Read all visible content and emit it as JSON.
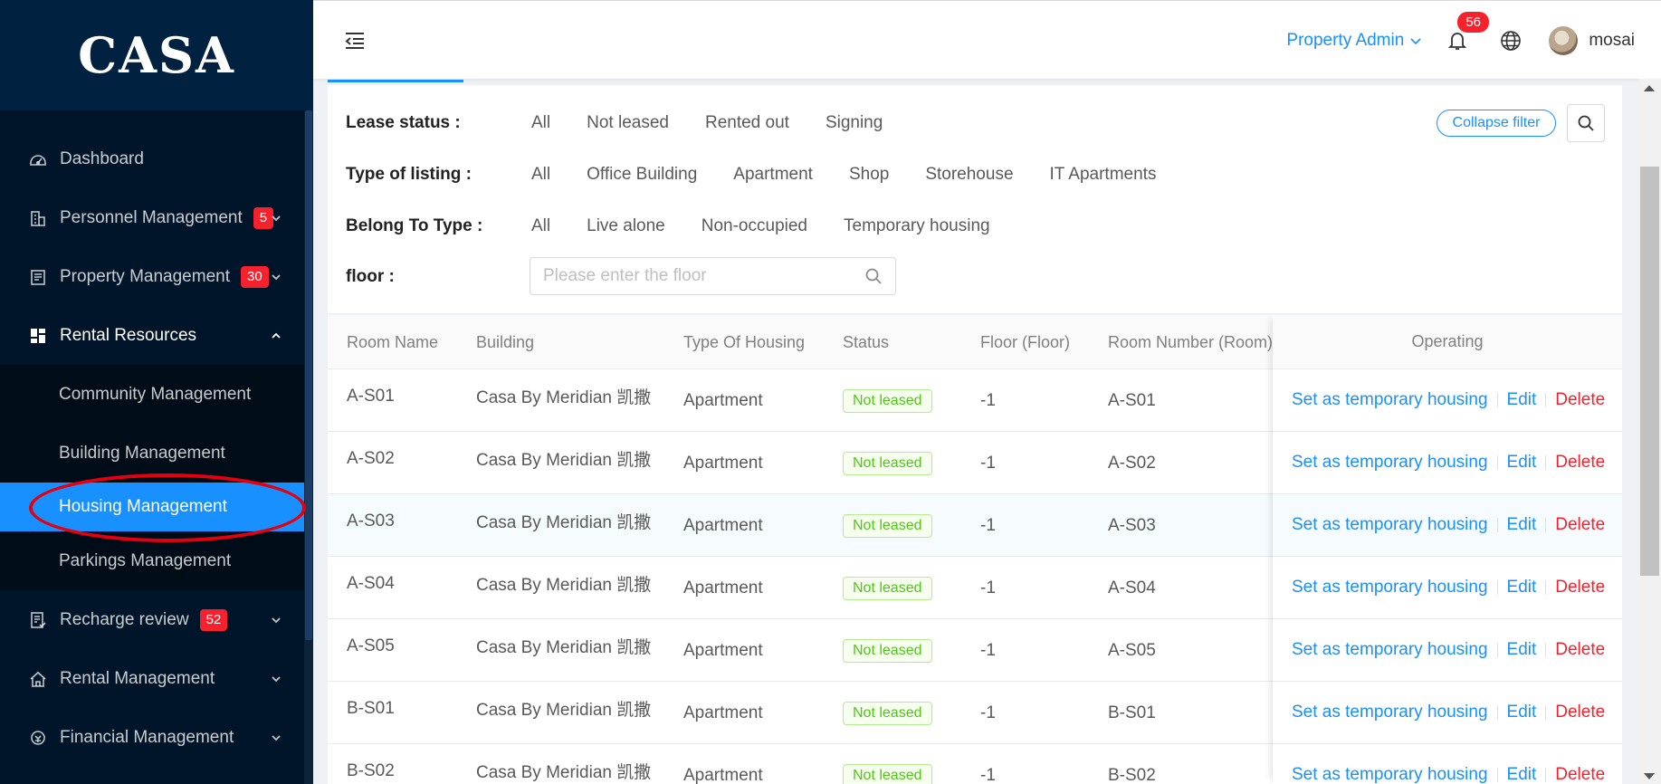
{
  "brand": {
    "logo": "CASA"
  },
  "sidebar": {
    "items": [
      {
        "label": "Dashboard",
        "icon": "dashboard-icon"
      },
      {
        "label": "Personnel Management",
        "icon": "building-icon",
        "badge": "5"
      },
      {
        "label": "Property Management",
        "icon": "document-icon",
        "badge": "30"
      },
      {
        "label": "Rental Resources",
        "icon": "grid-icon"
      },
      {
        "label": "Recharge review",
        "icon": "review-icon",
        "badge": "52"
      },
      {
        "label": "Rental Management",
        "icon": "house-icon"
      },
      {
        "label": "Financial Management",
        "icon": "finance-icon"
      }
    ],
    "submenu": [
      {
        "label": "Community Management"
      },
      {
        "label": "Building Management"
      },
      {
        "label": "Housing Management"
      },
      {
        "label": "Parkings Management"
      }
    ]
  },
  "header": {
    "role": "Property Admin",
    "notification_count": "56",
    "username": "mosai"
  },
  "filters": {
    "lease_status": {
      "label": "Lease status :",
      "options": [
        "All",
        "Not leased",
        "Rented out",
        "Signing"
      ]
    },
    "listing_type": {
      "label": "Type of listing :",
      "options": [
        "All",
        "Office Building",
        "Apartment",
        "Shop",
        "Storehouse",
        "IT Apartments"
      ]
    },
    "belong_to": {
      "label": "Belong To Type :",
      "options": [
        "All",
        "Live alone",
        "Non-occupied",
        "Temporary housing"
      ]
    },
    "floor": {
      "label": "floor :",
      "placeholder": "Please enter the floor"
    },
    "collapse_label": "Collapse filter"
  },
  "table": {
    "columns": [
      "Room Name",
      "Building",
      "Type Of Housing",
      "Status",
      "Floor (Floor)",
      "Room Number (Room)",
      "Operating"
    ],
    "rows": [
      {
        "room": "A-S01",
        "building": "Casa By Meridian 凯撒",
        "type": "Apartment",
        "status": "Not leased",
        "floor": "-1",
        "number": "A-S01"
      },
      {
        "room": "A-S02",
        "building": "Casa By Meridian 凯撒",
        "type": "Apartment",
        "status": "Not leased",
        "floor": "-1",
        "number": "A-S02"
      },
      {
        "room": "A-S03",
        "building": "Casa By Meridian 凯撒",
        "type": "Apartment",
        "status": "Not leased",
        "floor": "-1",
        "number": "A-S03"
      },
      {
        "room": "A-S04",
        "building": "Casa By Meridian 凯撒",
        "type": "Apartment",
        "status": "Not leased",
        "floor": "-1",
        "number": "A-S04"
      },
      {
        "room": "A-S05",
        "building": "Casa By Meridian 凯撒",
        "type": "Apartment",
        "status": "Not leased",
        "floor": "-1",
        "number": "A-S05"
      },
      {
        "room": "B-S01",
        "building": "Casa By Meridian 凯撒",
        "type": "Apartment",
        "status": "Not leased",
        "floor": "-1",
        "number": "B-S01"
      },
      {
        "room": "B-S02",
        "building": "Casa By Meridian 凯撒",
        "type": "Apartment",
        "status": "Not leased",
        "floor": "-1",
        "number": "B-S02"
      }
    ],
    "actions": {
      "temp": "Set as temporary housing",
      "edit": "Edit",
      "delete": "Delete"
    }
  },
  "colors": {
    "primary": "#1890ff",
    "danger": "#f5222d",
    "success": "#52c41a",
    "sider": "#001529"
  }
}
